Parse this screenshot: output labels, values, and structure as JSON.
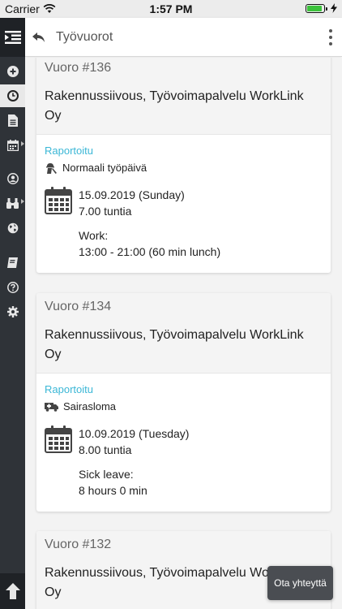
{
  "status_bar": {
    "carrier": "Carrier",
    "time": "1:57 PM",
    "battery_level": 0.95
  },
  "header": {
    "title": "Työvuorot"
  },
  "sidebar": {
    "items": [
      {
        "icon": "menu-collapse-icon"
      },
      {
        "icon": "plus-circle-icon"
      },
      {
        "icon": "clock-icon",
        "active": true
      },
      {
        "icon": "document-icon"
      },
      {
        "icon": "calendar-icon"
      },
      {
        "icon": "user-circle-icon"
      },
      {
        "icon": "binoculars-icon"
      },
      {
        "icon": "globe-icon"
      },
      {
        "icon": "book-icon"
      },
      {
        "icon": "help-icon"
      },
      {
        "icon": "gear-icon"
      },
      {
        "icon": "arrow-up-icon"
      }
    ]
  },
  "shifts": [
    {
      "id": "Vuoro #136",
      "company": "Rakennussiivous, Työvoimapalvelu WorkLink Oy",
      "status": "Raportoitu",
      "day_type": "Normaali työpäivä",
      "day_icon": "worker-icon",
      "date": "15.09.2019 (Sunday)",
      "hours": "7.00 tuntia",
      "detail_label": "Work:",
      "detail_value": "13:00 - 21:00 (60 min lunch)"
    },
    {
      "id": "Vuoro #134",
      "company": "Rakennussiivous, Työvoimapalvelu WorkLink Oy",
      "status": "Raportoitu",
      "day_type": "Sairasloma",
      "day_icon": "ambulance-icon",
      "date": "10.09.2019 (Tuesday)",
      "hours": "8.00 tuntia",
      "detail_label": "Sick leave:",
      "detail_value": "8 hours 0 min"
    },
    {
      "id": "Vuoro #132",
      "company": "Rakennussiivous, Työvoimapalvelu WorkLink Oy"
    }
  ],
  "contact_button": "Ota yhteyttä"
}
